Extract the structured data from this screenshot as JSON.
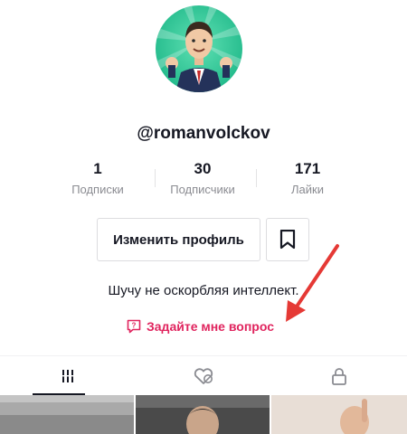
{
  "profile": {
    "username": "@romanvolckov",
    "bio": "Шучу не оскорбляя интеллект.",
    "question_link": "Задайте мне вопрос"
  },
  "stats": [
    {
      "value": "1",
      "label": "Подписки"
    },
    {
      "value": "30",
      "label": "Подписчики"
    },
    {
      "value": "171",
      "label": "Лайки"
    }
  ],
  "buttons": {
    "edit_profile": "Изменить профиль",
    "bookmark_icon": "bookmark-icon"
  },
  "tabs": [
    {
      "icon": "grid-icon",
      "active": true
    },
    {
      "icon": "liked-icon",
      "active": false
    },
    {
      "icon": "lock-icon",
      "active": false
    }
  ],
  "colors": {
    "accent": "#e0245e",
    "arrow": "#e53935",
    "text": "#161823",
    "secondary": "#8a8b91"
  }
}
